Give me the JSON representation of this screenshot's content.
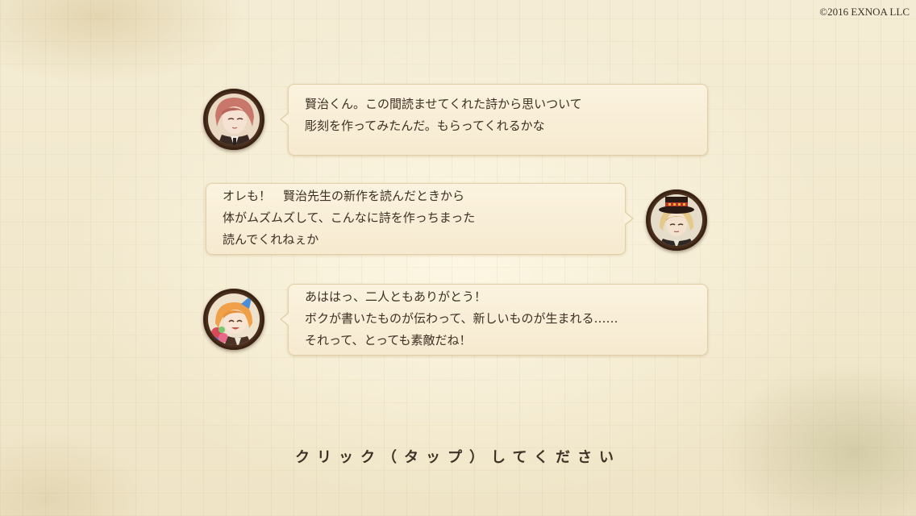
{
  "copyright": "©2016 EXNOA LLC",
  "messages": [
    {
      "side": "left",
      "character_icon": "red-haired-character-portrait",
      "lines": [
        "賢治くん。この間読ませてくれた詩から思いついて",
        "彫刻を作ってみたんだ。もらってくれるかな"
      ]
    },
    {
      "side": "right",
      "character_icon": "blond-character-with-hat-portrait",
      "lines": [
        "オレも！　賢治先生の新作を読んだときから",
        "体がムズムズして、こんなに詩を作っちまった",
        "読んでくれねぇか"
      ]
    },
    {
      "side": "left",
      "character_icon": "orange-haired-character-with-party-hat-portrait",
      "lines": [
        "あははっ、二人ともありがとう！",
        "ボクが書いたものが伝わって、新しいものが生まれる……",
        "それって、とっても素敵だね！"
      ]
    }
  ],
  "prompt": "クリック（タップ）してください",
  "colors": {
    "bubble_bg": "#f8eed6",
    "bubble_border": "#e2cfa6",
    "text": "#3d2f22",
    "avatar_frame": "#3a2214"
  }
}
